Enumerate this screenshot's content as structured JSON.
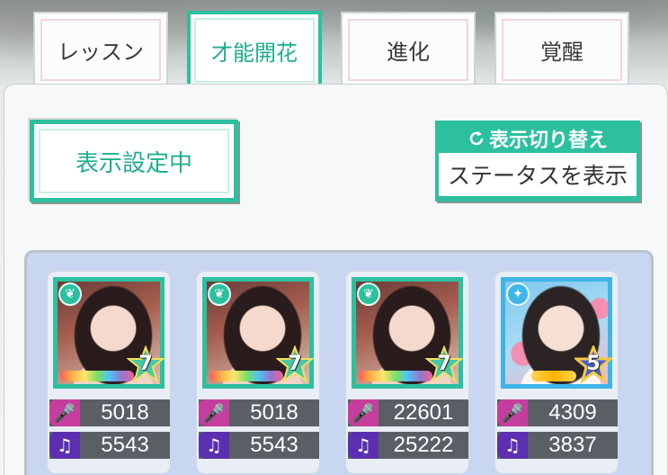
{
  "tabs": [
    {
      "label": "レッスン",
      "active": false
    },
    {
      "label": "才能開花",
      "active": true
    },
    {
      "label": "進化",
      "active": false
    },
    {
      "label": "覚醒",
      "active": false
    }
  ],
  "display_setting_label": "表示設定中",
  "toggle": {
    "header": "表示切り替え",
    "body": "ステータスを表示"
  },
  "colors": {
    "accent": "#2cc09f",
    "vocal": "#c53e9e",
    "dance": "#5b2fb0",
    "card_bg": "#c8d6f2"
  },
  "cards": [
    {
      "rarity": "7",
      "attr_icon": "leaf-icon",
      "vocal": "5018",
      "dance": "5543"
    },
    {
      "rarity": "7",
      "attr_icon": "leaf-icon",
      "vocal": "5018",
      "dance": "5543"
    },
    {
      "rarity": "7",
      "attr_icon": "leaf-icon",
      "vocal": "22601",
      "dance": "25222"
    },
    {
      "rarity": "5",
      "attr_icon": "sparkle-icon",
      "vocal": "4309",
      "dance": "3837"
    }
  ]
}
